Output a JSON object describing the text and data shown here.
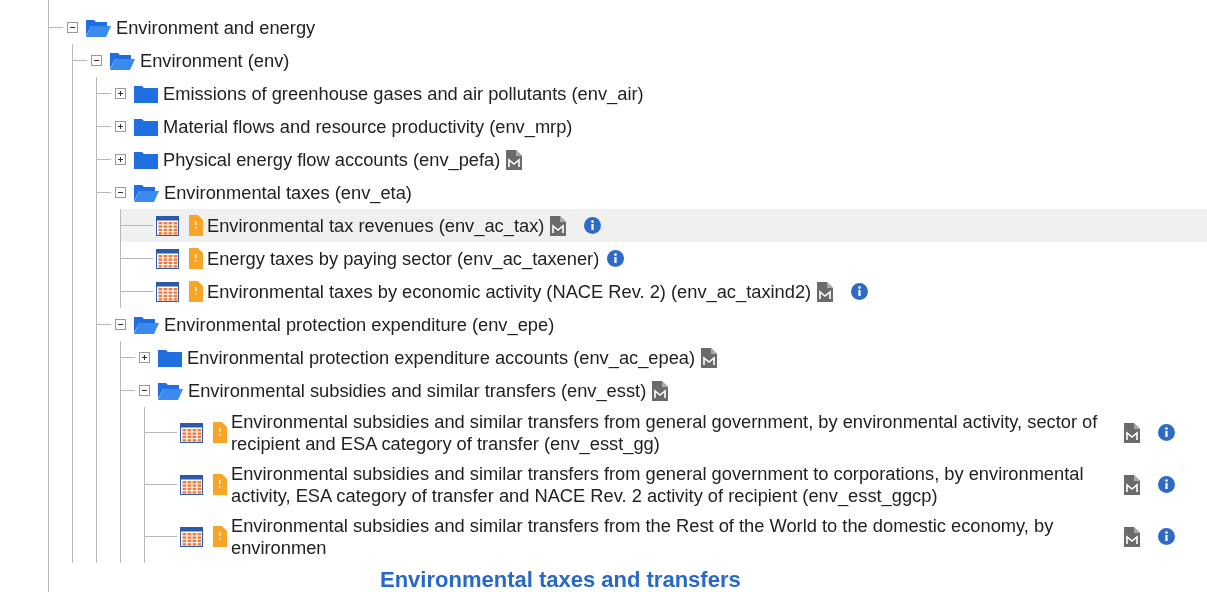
{
  "tree": [
    {
      "label": "Environment and energy",
      "kind": "folder",
      "expanded": true,
      "selected": false,
      "children": [
        {
          "label": "Environment (env)",
          "kind": "folder",
          "expanded": true,
          "selected": false,
          "children": [
            {
              "label": "Emissions of greenhouse gases and air pollutants (env_air)",
              "kind": "folder",
              "expanded": false,
              "selected": false
            },
            {
              "label": "Material flows and resource productivity (env_mrp)",
              "kind": "folder",
              "expanded": false,
              "selected": false
            },
            {
              "label": "Physical energy flow accounts (env_pefa)",
              "kind": "folder",
              "expanded": false,
              "selected": false,
              "metadata": true
            },
            {
              "label": "Environmental taxes (env_eta)",
              "kind": "folder",
              "expanded": true,
              "selected": false,
              "children": [
                {
                  "label": "Environmental tax revenues (env_ac_tax)",
                  "kind": "table",
                  "selected": true,
                  "metadata": true,
                  "info": true
                },
                {
                  "label": "Energy taxes by paying sector (env_ac_taxener)",
                  "kind": "table",
                  "selected": false,
                  "info": true
                },
                {
                  "label": "Environmental taxes by economic activity (NACE Rev. 2) (env_ac_taxind2)",
                  "kind": "table",
                  "selected": false,
                  "metadata": true,
                  "info": true
                }
              ]
            },
            {
              "label": "Environmental protection expenditure (env_epe)",
              "kind": "folder",
              "expanded": true,
              "selected": false,
              "children": [
                {
                  "label": "Environmental protection expenditure accounts (env_ac_epea)",
                  "kind": "folder",
                  "expanded": false,
                  "selected": false,
                  "metadata": true
                },
                {
                  "label": "Environmental subsidies and similar transfers (env_esst)",
                  "kind": "folder",
                  "expanded": true,
                  "selected": false,
                  "metadata": true,
                  "children": [
                    {
                      "label": "Environmental subsidies and similar transfers from general government, by environmental activity, sector of recipient and ESA category of transfer (env_esst_gg)",
                      "kind": "table",
                      "selected": false,
                      "metadata": true,
                      "info": true
                    },
                    {
                      "label": "Environmental subsidies and similar transfers from general government to corporations, by environmental activity, ESA category of transfer and NACE Rev. 2 activity of recipient (env_esst_ggcp)",
                      "kind": "table",
                      "selected": false,
                      "metadata": true,
                      "info": true
                    },
                    {
                      "label": "Environmental subsidies and similar transfers from the Rest of the World to the domestic economy, by environmen",
                      "kind": "table",
                      "selected": false,
                      "metadata": true,
                      "info": true
                    }
                  ]
                }
              ]
            }
          ]
        }
      ]
    }
  ],
  "overlay_heading": "Environmental taxes and transfers"
}
